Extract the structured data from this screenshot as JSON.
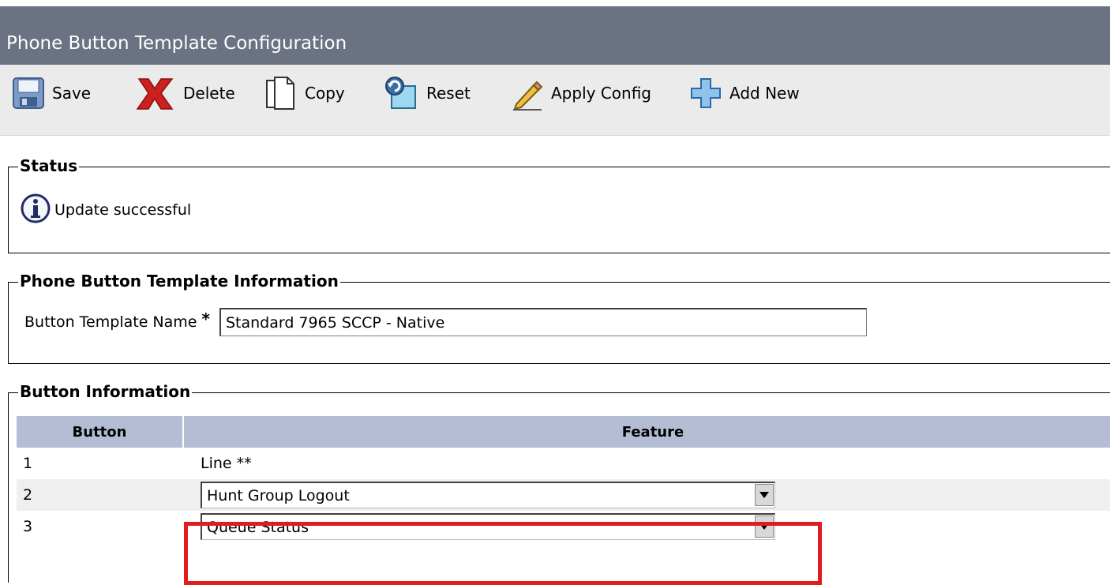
{
  "header": {
    "title": "Phone Button Template Configuration"
  },
  "toolbar": {
    "save": {
      "label": "Save",
      "icon": "save-disk-icon"
    },
    "delete": {
      "label": "Delete",
      "icon": "red-x-icon"
    },
    "copy": {
      "label": "Copy",
      "icon": "copy-pages-icon"
    },
    "reset": {
      "label": "Reset",
      "icon": "reset-arrow-icon"
    },
    "apply": {
      "label": "Apply Config",
      "icon": "pencil-icon"
    },
    "addnew": {
      "label": "Add New",
      "icon": "blue-plus-icon"
    }
  },
  "status": {
    "legend": "Status",
    "message": "Update successful",
    "icon": "info-icon"
  },
  "info": {
    "legend": "Phone Button Template Information",
    "name_label": "Button Template Name",
    "required_marker": "*",
    "name_value": "Standard 7965 SCCP - Native"
  },
  "buttons": {
    "legend": "Button Information",
    "columns": [
      "Button",
      "Feature"
    ],
    "rows": [
      {
        "button": "1",
        "feature": "Line **"
      },
      {
        "button": "2",
        "feature": "Hunt Group Logout"
      },
      {
        "button": "3",
        "feature": "Queue Status"
      }
    ]
  },
  "colors": {
    "title_bar": "#6b7382",
    "toolbar": "#ebebeb",
    "table_header": "#b4bdd4",
    "highlight": "#e01c1c"
  }
}
